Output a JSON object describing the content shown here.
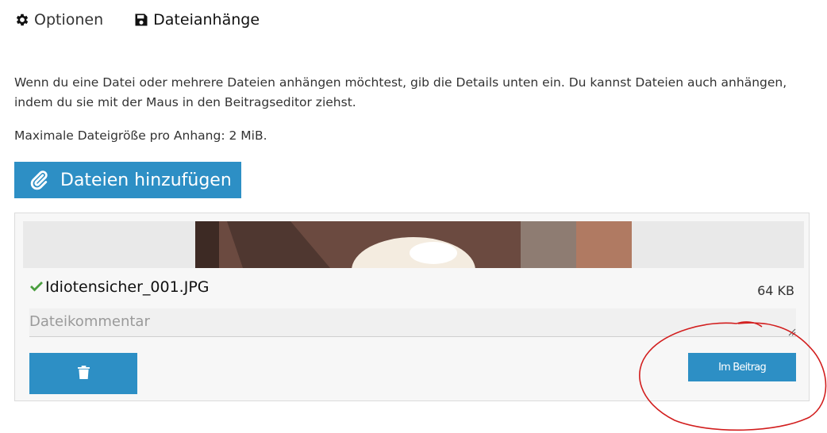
{
  "tabs": [
    {
      "label": "Optionen",
      "icon": "gear-icon"
    },
    {
      "label": "Dateianhänge",
      "icon": "floppy-disk-icon",
      "active": true
    }
  ],
  "intro": {
    "text": "Wenn du eine Datei oder mehrere Dateien anhängen möchtest, gib die Details unten ein. Du kannst Dateien auch anhängen, indem du sie mit der Maus in den Beitragseditor ziehst.",
    "max_size": "Maximale Dateigröße pro Anhang: 2 MiB."
  },
  "add_button": {
    "label": "Dateien hinzufügen",
    "icon": "paperclip-icon"
  },
  "attachment": {
    "filename": "Idiotensicher_001.JPG",
    "size": "64 KB",
    "comment_placeholder": "Dateikommentar",
    "comment_value": "",
    "delete_icon": "trash-icon",
    "insert_label": "Im Beitrag"
  },
  "colors": {
    "accent": "#2d8fc5",
    "check": "#4a9e3f",
    "annotation": "#d21e1e",
    "box_bg": "#f7f7f7"
  }
}
